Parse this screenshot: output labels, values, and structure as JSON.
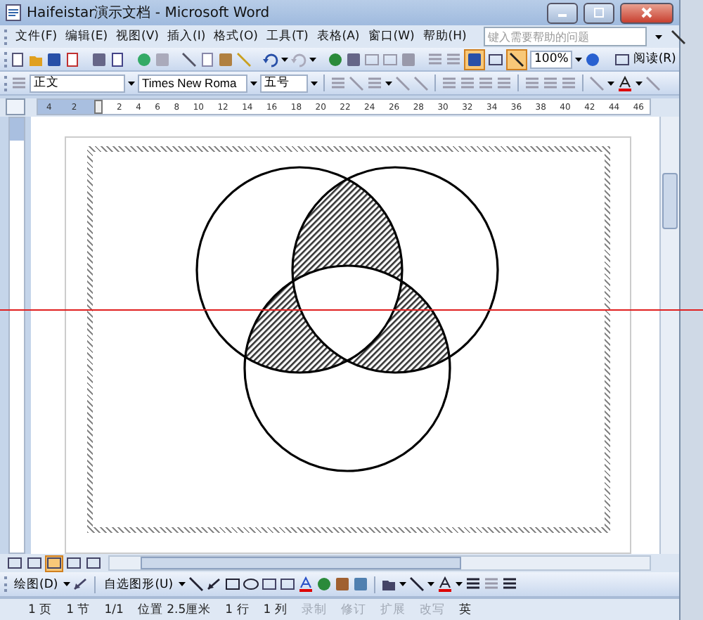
{
  "window": {
    "title": "Haifeistar演示文档 - Microsoft Word"
  },
  "menu": [
    "文件(F)",
    "编辑(E)",
    "视图(V)",
    "插入(I)",
    "格式(O)",
    "工具(T)",
    "表格(A)",
    "窗口(W)",
    "帮助(H)"
  ],
  "help_search": {
    "placeholder": "键入需要帮助的问题"
  },
  "standard_toolbar": {
    "zoom": "100%",
    "read_button": "阅读(R)"
  },
  "formatting_toolbar": {
    "style": "正文",
    "font": "Times New Roma",
    "size": "五号"
  },
  "ruler": {
    "left_labels": [
      "4",
      "2"
    ],
    "labels": [
      "2",
      "4",
      "6",
      "8",
      "10",
      "12",
      "14",
      "16",
      "18",
      "20",
      "22",
      "24",
      "26",
      "28",
      "30",
      "32",
      "34",
      "36",
      "38",
      "40",
      "42",
      "44",
      "46"
    ]
  },
  "view_buttons": [
    {
      "selected": false
    },
    {
      "selected": false
    },
    {
      "selected": true
    },
    {
      "selected": false
    },
    {
      "selected": false
    }
  ],
  "drawing_toolbar": {
    "draw_menu": "绘图(D)",
    "autoshapes_menu": "自选图形(U)"
  },
  "status_bar": [
    {
      "text": "1 页",
      "disabled": false
    },
    {
      "text": "1 节",
      "disabled": false
    },
    {
      "text": "1/1",
      "disabled": false
    },
    {
      "text": "位置 2.5厘米",
      "disabled": false
    },
    {
      "text": "1 行",
      "disabled": false
    },
    {
      "text": "1 列",
      "disabled": false
    },
    {
      "text": "录制",
      "disabled": true
    },
    {
      "text": "修订",
      "disabled": true
    },
    {
      "text": "扩展",
      "disabled": true
    },
    {
      "text": "改写",
      "disabled": true
    },
    {
      "text": "英",
      "disabled": false
    }
  ]
}
